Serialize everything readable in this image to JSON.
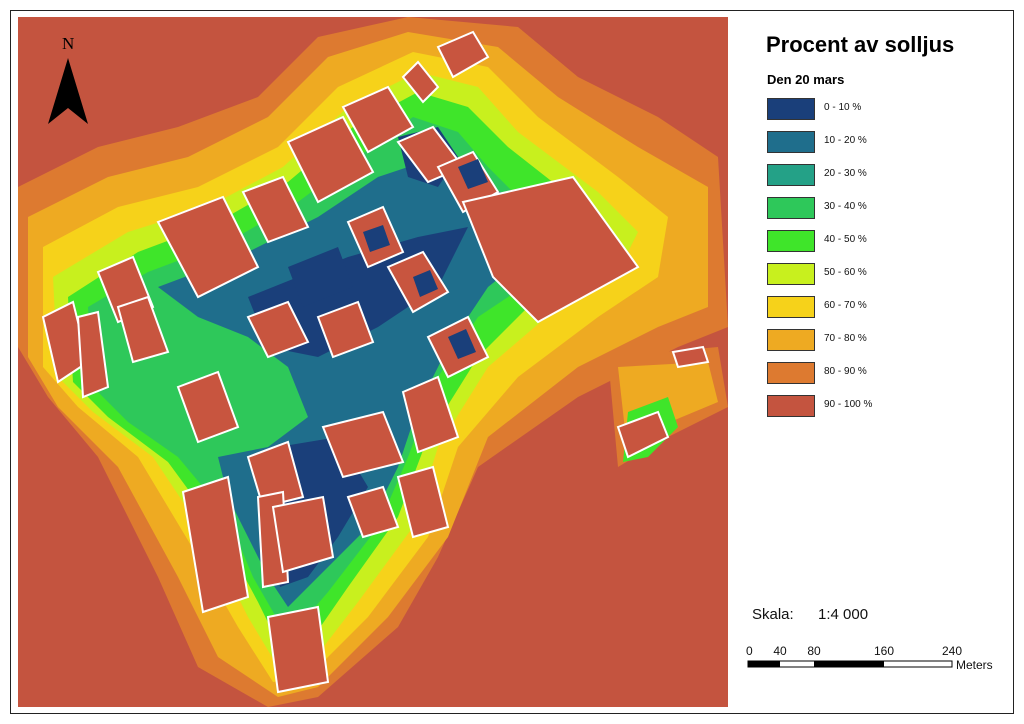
{
  "legend": {
    "title": "Procent av solljus",
    "subtitle": "Den 20 mars",
    "items": [
      {
        "label": "0 - 10 %",
        "color": "#1a3f7a"
      },
      {
        "label": "10 - 20 %",
        "color": "#1f6e8c"
      },
      {
        "label": "20 - 30 %",
        "color": "#24a187"
      },
      {
        "label": "30 - 40 %",
        "color": "#2ec85a"
      },
      {
        "label": "40 - 50 %",
        "color": "#3fe52a"
      },
      {
        "label": "50 - 60 %",
        "color": "#c8f01e"
      },
      {
        "label": "60 - 70 %",
        "color": "#f6d21a"
      },
      {
        "label": "70 - 80 %",
        "color": "#eeaa22"
      },
      {
        "label": "80 - 90 %",
        "color": "#dd7a30"
      },
      {
        "label": "90 - 100 %",
        "color": "#c4543f"
      }
    ]
  },
  "scale": {
    "label": "Skala:",
    "ratio": "1:4 000",
    "ticks": [
      "0",
      "40",
      "80",
      "160",
      "240"
    ],
    "unit": "Meters"
  },
  "north_arrow": {
    "label": "N",
    "icon": "north-arrow-icon"
  },
  "colors": {
    "background_full_sun": "#c4543f",
    "building_fill": "#c8553f",
    "building_outline": "#ffffff"
  }
}
